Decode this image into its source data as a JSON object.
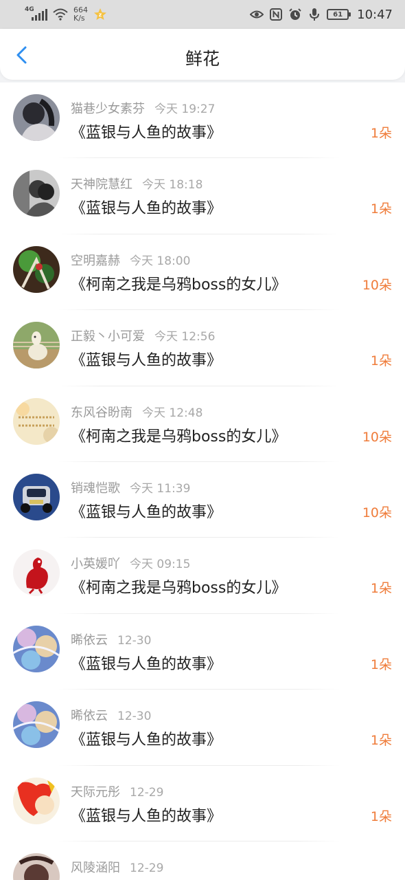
{
  "status_bar": {
    "network": "4G",
    "speed_value": "664",
    "speed_unit": "K/s",
    "battery": "61",
    "time": "10:47",
    "icons": [
      "signal-icon",
      "wifi-icon",
      "vip-badge-icon",
      "eye-icon",
      "nfc-icon",
      "alarm-icon",
      "mic-icon",
      "battery-icon"
    ]
  },
  "header": {
    "title": "鲜花",
    "back_icon": "chevron-left-icon"
  },
  "colors": {
    "accent_back": "#2f8ff0",
    "count": "#ef7c3a",
    "meta": "#9a9a9a"
  },
  "flowers": [
    {
      "user": "猫巷少女素芬",
      "time": "今天 19:27",
      "book": "《蓝银与人鱼的故事》",
      "count": "1朵"
    },
    {
      "user": "天神院慧红",
      "time": "今天 18:18",
      "book": "《蓝银与人鱼的故事》",
      "count": "1朵"
    },
    {
      "user": "空明嘉赫",
      "time": "今天 18:00",
      "book": "《柯南之我是乌鸦boss的女儿》",
      "count": "10朵"
    },
    {
      "user": "正毅丶小可爱",
      "time": "今天 12:56",
      "book": "《蓝银与人鱼的故事》",
      "count": "1朵"
    },
    {
      "user": "东风谷盼南",
      "time": "今天 12:48",
      "book": "《柯南之我是乌鸦boss的女儿》",
      "count": "10朵"
    },
    {
      "user": "销魂恺歌",
      "time": "今天 11:39",
      "book": "《蓝银与人鱼的故事》",
      "count": "10朵"
    },
    {
      "user": "小英媛吖",
      "time": "今天 09:15",
      "book": "《柯南之我是乌鸦boss的女儿》",
      "count": "1朵"
    },
    {
      "user": "晞依云",
      "time": "12-30",
      "book": "《蓝银与人鱼的故事》",
      "count": "1朵"
    },
    {
      "user": "晞依云",
      "time": "12-30",
      "book": "《蓝银与人鱼的故事》",
      "count": "1朵"
    },
    {
      "user": "天际元彤",
      "time": "12-29",
      "book": "《蓝银与人鱼的故事》",
      "count": "1朵"
    },
    {
      "user": "风陵涵阳",
      "time": "12-29",
      "book": "",
      "count": ""
    }
  ]
}
